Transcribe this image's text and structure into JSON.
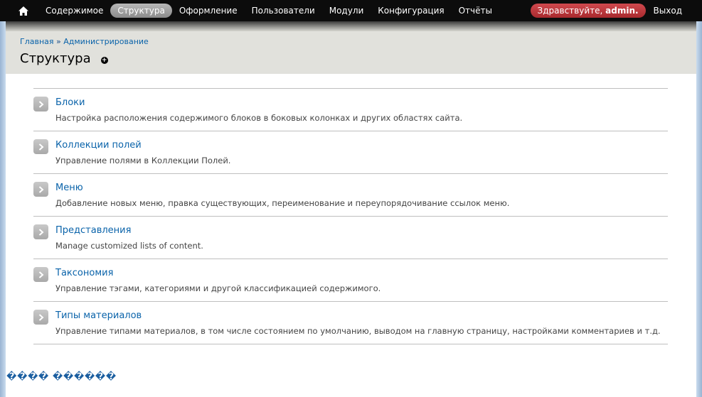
{
  "toolbar": {
    "home_icon": "home-icon",
    "nav": [
      {
        "label": "Содержимое",
        "active": false
      },
      {
        "label": "Структура",
        "active": true
      },
      {
        "label": "Оформление",
        "active": false
      },
      {
        "label": "Пользователи",
        "active": false
      },
      {
        "label": "Модули",
        "active": false
      },
      {
        "label": "Конфигурация",
        "active": false
      },
      {
        "label": "Отчёты",
        "active": false
      }
    ],
    "greeting_prefix": "Здравствуйте, ",
    "greeting_user": "admin.",
    "logout": "Выход"
  },
  "breadcrumb": {
    "items": [
      "Главная",
      "Администрирование"
    ],
    "separator": " » "
  },
  "page": {
    "title": "Структура",
    "shortcut_icon": "add-shortcut-icon"
  },
  "items": [
    {
      "title": "Блоки",
      "description": "Настройка расположения содержимого блоков в боковых колонках и других областях сайта."
    },
    {
      "title": "Коллекции полей",
      "description": "Управление полями в Коллекции Полей."
    },
    {
      "title": "Меню",
      "description": "Добавление новых меню, правка существующих, переименование и переупорядочивание ссылок меню."
    },
    {
      "title": "Представления",
      "description": "Manage customized lists of content."
    },
    {
      "title": "Таксономия",
      "description": "Управление тэгами, категориями и другой классификацией содержимого."
    },
    {
      "title": "Типы материалов",
      "description": "Управление типами материалов, в том числе состоянием по умолчанию, выводом на главную страницу, настройками комментариев и т.д."
    }
  ],
  "footer": {
    "text": "���� ������"
  },
  "colors": {
    "link": "#0a63aa",
    "toolbar_bg": "#0c0c0c",
    "active_tab": "#9a9a9a",
    "greeting_bg": "#c0393e",
    "header_bg": "#e1e1dc"
  }
}
